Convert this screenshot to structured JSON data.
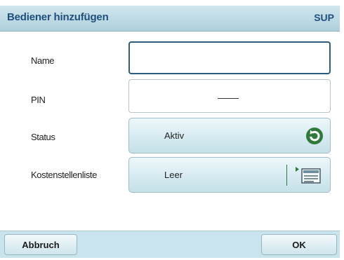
{
  "header": {
    "title": "Bediener hinzufügen",
    "role": "SUP"
  },
  "form": {
    "name_label": "Name",
    "name_value": "",
    "pin_label": "PIN",
    "pin_value": "",
    "status_label": "Status",
    "status_value": "Aktiv",
    "cost_label": "Kostenstellenliste",
    "cost_value": "Leer"
  },
  "footer": {
    "cancel_label": "Abbruch",
    "ok_label": "OK"
  },
  "icons": {
    "status_toggle": "refresh-icon",
    "cost_list": "list-icon"
  },
  "colors": {
    "title_text": "#1f4f7c",
    "accent_green": "#2f7a3b"
  }
}
